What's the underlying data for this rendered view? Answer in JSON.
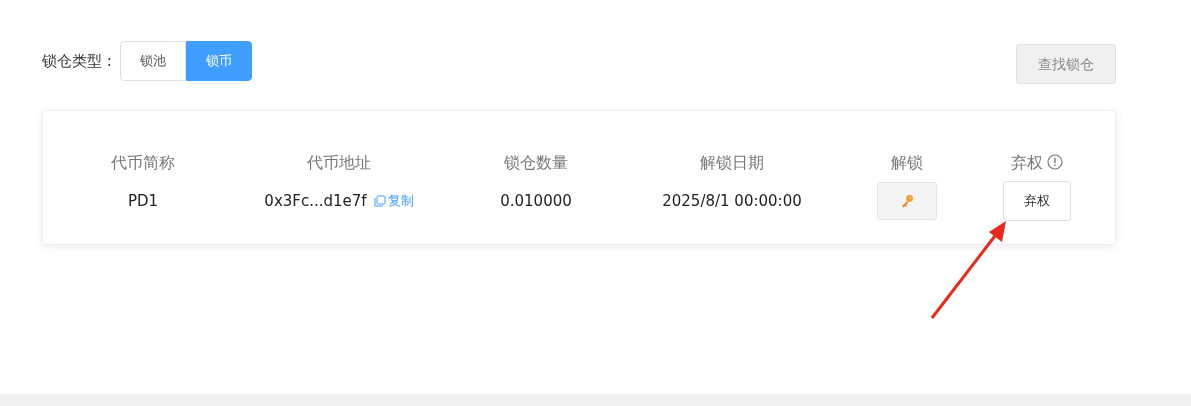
{
  "filter": {
    "label": "锁仓类型 :",
    "options": [
      {
        "label": "锁池",
        "selected": false
      },
      {
        "label": "锁币",
        "selected": true
      }
    ]
  },
  "search_button": {
    "label": "查找锁仓",
    "disabled": true
  },
  "table": {
    "columns": [
      "代币简称",
      "代币地址",
      "锁仓数量",
      "解锁日期",
      "解锁",
      "弃权"
    ],
    "rows": [
      {
        "symbol": "PD1",
        "address": "0x3Fc...d1e7f",
        "copy_label": "复制",
        "amount": "0.010000",
        "unlock_date": "2025/8/1 00:00:00",
        "unlock_disabled": true,
        "renounce_label": "弃权"
      }
    ]
  }
}
